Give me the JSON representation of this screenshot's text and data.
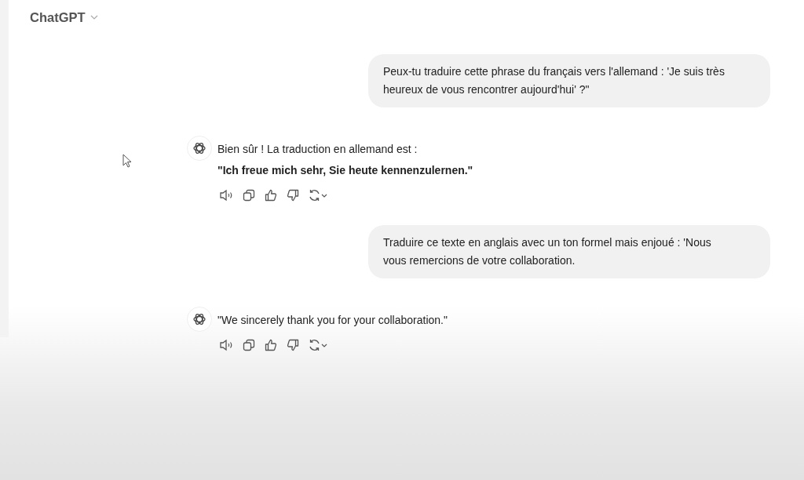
{
  "header": {
    "title": "ChatGPT"
  },
  "messages": [
    {
      "kind": "user",
      "text": "Peux-tu traduire cette phrase du français vers l'allemand : 'Je suis très heureux de vous rencontrer aujourd'hui' ?\""
    },
    {
      "kind": "assistant",
      "text": "Bien sûr ! La traduction en allemand est :\n**\"Ich freue mich sehr, Sie heute kennenzulernen.\"**"
    },
    {
      "kind": "user",
      "text": "Traduire ce texte en anglais avec un ton formel mais enjoué : 'Nous vous remercions de votre collaboration."
    },
    {
      "kind": "assistant",
      "text": "\"We sincerely thank you for your collaboration.\""
    }
  ]
}
